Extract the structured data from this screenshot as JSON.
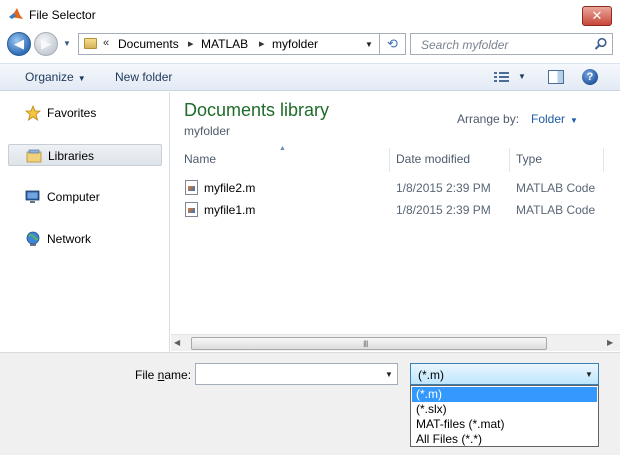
{
  "window": {
    "title": "File Selector",
    "close_glyph": "✕"
  },
  "nav": {
    "back_glyph": "◀",
    "forward_glyph": "▶",
    "breadcrumb": [
      "Documents",
      "MATLAB",
      "myfolder"
    ],
    "overflow": "«",
    "separator": "▸",
    "refresh_glyph": "⟲",
    "search_placeholder": "Search myfolder"
  },
  "toolbar": {
    "organize_label": "Organize",
    "new_folder_label": "New folder",
    "help_glyph": "?"
  },
  "sidebar": {
    "items": [
      {
        "label": "Favorites",
        "icon": "star-icon"
      },
      {
        "label": "Libraries",
        "icon": "libraries-icon",
        "selected": true
      },
      {
        "label": "Computer",
        "icon": "computer-icon"
      },
      {
        "label": "Network",
        "icon": "network-icon"
      }
    ]
  },
  "content": {
    "library_title": "Documents library",
    "library_subtitle": "myfolder",
    "arrange_label": "Arrange by:",
    "arrange_value": "Folder",
    "columns": [
      "Name",
      "Date modified",
      "Type"
    ],
    "files": [
      {
        "name": "myfile2.m",
        "date": "1/8/2015 2:39 PM",
        "type": "MATLAB Code"
      },
      {
        "name": "myfile1.m",
        "date": "1/8/2015 2:39 PM",
        "type": "MATLAB Code"
      }
    ]
  },
  "scrollbar": {
    "grip": "III"
  },
  "footer": {
    "filename_label_pre": "File ",
    "filename_label_accel": "n",
    "filename_label_post": "ame:",
    "filename_value": "",
    "filter_value": "(*.m)",
    "filter_options": [
      "(*.m)",
      "(*.slx)",
      "MAT-files (*.mat)",
      "All Files (*.*)"
    ]
  },
  "colors": {
    "library_title": "#1f6b2a",
    "highlight": "#3399ff",
    "link_blue": "#1f5ba6"
  }
}
